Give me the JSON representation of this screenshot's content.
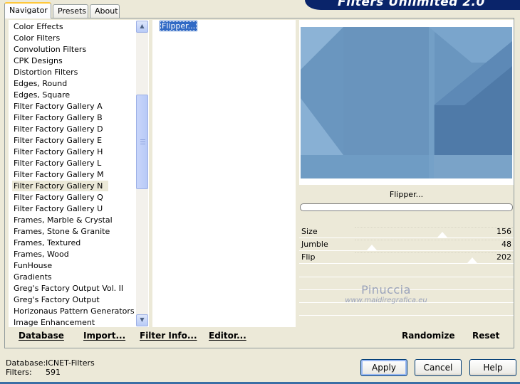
{
  "tabs": [
    {
      "label": "Navigator",
      "active": true
    },
    {
      "label": "Presets",
      "active": false
    },
    {
      "label": "About",
      "active": false
    }
  ],
  "banner": {
    "title": "Filters Unlimited 2.0"
  },
  "categories": {
    "items": [
      "Color Effects",
      "Color Filters",
      "Convolution Filters",
      "CPK Designs",
      "Distortion Filters",
      "Edges, Round",
      "Edges, Square",
      "Filter Factory Gallery A",
      "Filter Factory Gallery B",
      "Filter Factory Gallery D",
      "Filter Factory Gallery E",
      "Filter Factory Gallery H",
      "Filter Factory Gallery L",
      "Filter Factory Gallery M",
      "Filter Factory Gallery N",
      "Filter Factory Gallery Q",
      "Filter Factory Gallery U",
      "Frames, Marble & Crystal",
      "Frames, Stone & Granite",
      "Frames, Textured",
      "Frames, Wood",
      "FunHouse",
      "Gradients",
      "Greg's Factory Output Vol. II",
      "Greg's Factory Output",
      "Horizonaus Pattern Generators",
      "Image Enhancement"
    ],
    "selected": "Filter Factory Gallery N"
  },
  "filters": {
    "items": [
      "Flipper..."
    ],
    "selected": "Flipper..."
  },
  "preview": {
    "filter_name": "Flipper...",
    "progress": 0
  },
  "params": [
    {
      "label": "Size",
      "value": "156",
      "level": 0.61
    },
    {
      "label": "Jumble",
      "value": "48",
      "level": 0.19
    },
    {
      "label": "Flip",
      "value": "202",
      "level": 0.79
    }
  ],
  "watermark": {
    "line1": "Pinuccia",
    "line2": "www.maidiregrafica.eu"
  },
  "toolbar": {
    "database": "Database",
    "import": "Import...",
    "filter_info": "Filter Info...",
    "editor": "Editor...",
    "randomize": "Randomize",
    "reset": "Reset"
  },
  "status": {
    "database_label": "Database:",
    "database_value": "ICNET-Filters",
    "filters_label": "Filters:",
    "filters_value": "591"
  },
  "buttons": {
    "apply": "Apply",
    "cancel": "Cancel",
    "help": "Help"
  },
  "colors": {
    "selection": "#316ac5",
    "preview_base": "#6a96bf",
    "banner": "#0a246a"
  }
}
